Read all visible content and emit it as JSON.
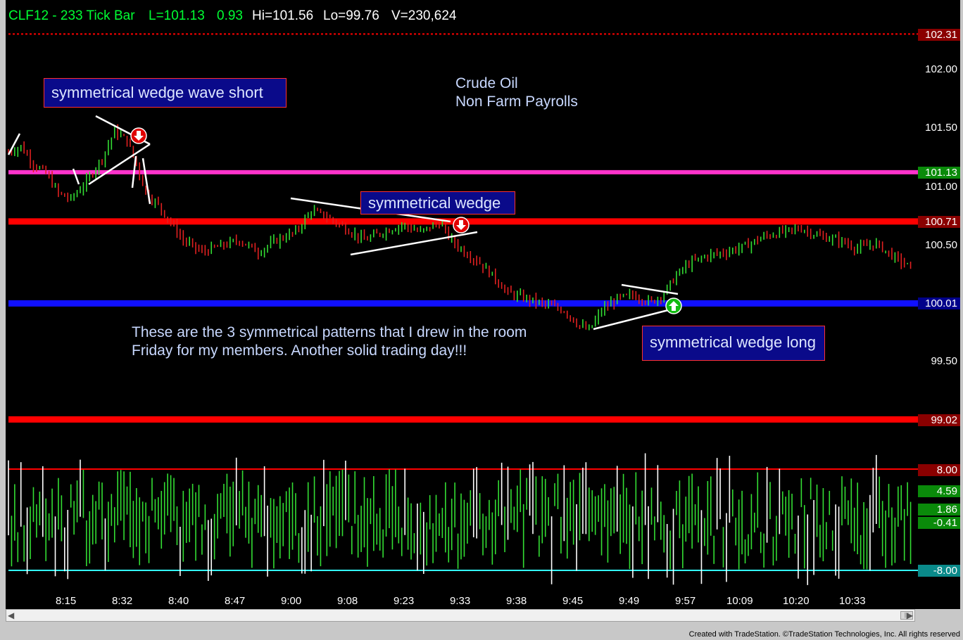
{
  "header": {
    "symbol": "CLF12 - 233 Tick Bar",
    "last": "L=101.13",
    "change": "0.93",
    "hi": "Hi=101.56",
    "lo": "Lo=99.76",
    "vol": "V=230,624"
  },
  "annotations": {
    "title_line1": "Crude Oil",
    "title_line2": "Non Farm Payrolls",
    "box1": "symmetrical wedge wave short",
    "box2": "symmetrical wedge",
    "box3": "symmetrical wedge long",
    "note_line1": "These are the 3 symmetrical patterns that I drew in the room",
    "note_line2": "Friday for my members. Another solid trading day!!!"
  },
  "price_tags": {
    "top": "102.31",
    "magenta": "101.13",
    "red_upper": "100.71",
    "blue": "100.01",
    "red_lower": "99.02"
  },
  "osc_tags": {
    "upper": "8.00",
    "v1": "4.59",
    "v2": "1.86",
    "v3": "-0.41",
    "lower": "-8.00"
  },
  "colors": {
    "up_bar": "#33dd33",
    "down_bar": "#e02020",
    "magenta_line": "#ff33cc",
    "red_line": "#ff0000",
    "blue_line": "#1010ff",
    "osc_bar": "#33dd33",
    "cyan_line": "#33ffff"
  },
  "footer": {
    "credit": "Created with TradeStation. ©TradeStation Technologies, Inc. All rights reserved"
  },
  "chart_data": [
    {
      "type": "candlestick",
      "title": "CLF12 - 233 Tick Bar",
      "ylim": [
        99.1,
        102.3
      ],
      "y_ticks": [
        "102.00",
        "101.50",
        "101.00",
        "100.50",
        "99.50"
      ],
      "x_ticks": [
        "8:15",
        "8:32",
        "8:40",
        "8:47",
        "9:00",
        "9:08",
        "9:23",
        "9:33",
        "9:38",
        "9:45",
        "9:49",
        "9:57",
        "10:09",
        "10:20",
        "10:33"
      ],
      "horizontal_levels": [
        {
          "value": 102.31,
          "style": "dotted",
          "color": "red"
        },
        {
          "value": 101.13,
          "color": "magenta"
        },
        {
          "value": 100.71,
          "color": "red"
        },
        {
          "value": 100.01,
          "color": "blue"
        },
        {
          "value": 99.02,
          "color": "red"
        }
      ],
      "close_path": [
        [
          0,
          101.3
        ],
        [
          4,
          101.35
        ],
        [
          8,
          101.2
        ],
        [
          12,
          101.12
        ],
        [
          16,
          100.95
        ],
        [
          20,
          100.9
        ],
        [
          25,
          101.05
        ],
        [
          30,
          101.25
        ],
        [
          34,
          101.48
        ],
        [
          38,
          101.4
        ],
        [
          41,
          101.2
        ],
        [
          44,
          100.95
        ],
        [
          48,
          100.85
        ],
        [
          52,
          100.7
        ],
        [
          56,
          100.55
        ],
        [
          62,
          100.45
        ],
        [
          68,
          100.5
        ],
        [
          74,
          100.55
        ],
        [
          80,
          100.45
        ],
        [
          86,
          100.55
        ],
        [
          92,
          100.62
        ],
        [
          97,
          100.8
        ],
        [
          102,
          100.75
        ],
        [
          108,
          100.65
        ],
        [
          114,
          100.55
        ],
        [
          120,
          100.62
        ],
        [
          126,
          100.68
        ],
        [
          132,
          100.62
        ],
        [
          138,
          100.7
        ],
        [
          142,
          100.55
        ],
        [
          146,
          100.45
        ],
        [
          150,
          100.38
        ],
        [
          155,
          100.25
        ],
        [
          160,
          100.1
        ],
        [
          166,
          100.05
        ],
        [
          172,
          100.0
        ],
        [
          178,
          99.95
        ],
        [
          183,
          99.82
        ],
        [
          186,
          99.78
        ],
        [
          190,
          99.95
        ],
        [
          195,
          100.05
        ],
        [
          200,
          100.08
        ],
        [
          206,
          100.02
        ],
        [
          210,
          100.1
        ],
        [
          214,
          100.25
        ],
        [
          218,
          100.35
        ],
        [
          224,
          100.42
        ],
        [
          230,
          100.45
        ],
        [
          236,
          100.5
        ],
        [
          242,
          100.58
        ],
        [
          248,
          100.62
        ],
        [
          254,
          100.65
        ],
        [
          260,
          100.58
        ],
        [
          266,
          100.55
        ],
        [
          272,
          100.48
        ],
        [
          278,
          100.52
        ],
        [
          284,
          100.4
        ],
        [
          290,
          100.3
        ]
      ],
      "bar_count": 290
    },
    {
      "type": "oscillator",
      "ylim": [
        -8.0,
        8.0
      ],
      "levels": [
        8.0,
        -8.0
      ],
      "last_values": [
        4.59,
        1.86,
        -0.41
      ],
      "bar_count": 290
    }
  ]
}
